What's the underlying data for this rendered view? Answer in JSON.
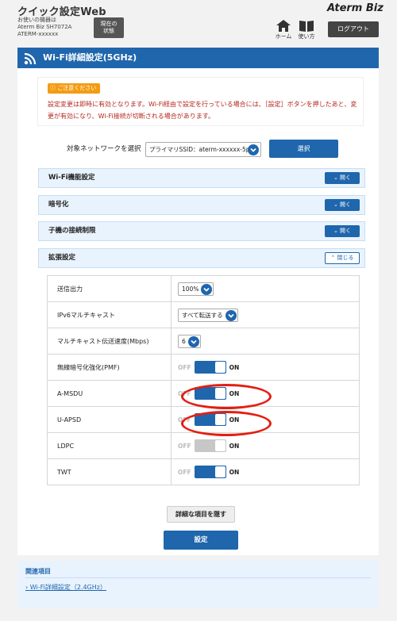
{
  "header": {
    "app_title": "クイック設定Web",
    "device_line1": "お使いの機器は",
    "device_line2": "Aterm Biz SH7072A",
    "device_line3": "ATERM-xxxxxx",
    "status_line1": "現在の",
    "status_line2": "状態",
    "brand": "Aterm Biz",
    "home_label": "ホーム",
    "help_label": "使い方",
    "logout_label": "ログアウト"
  },
  "page": {
    "title": "Wi-Fi詳細設定(5GHz)"
  },
  "notice": {
    "badge": "ご注意ください",
    "text": "設定変更は即時に有効となります。Wi-Fi経由で設定を行っている場合には、［設定］ボタンを押したあと、変更が有効になり、Wi-Fi接続が切断される場合があります。"
  },
  "network": {
    "label": "対象ネットワークを選択",
    "selected": "プライマリSSID：aterm-xxxxxx-5p",
    "select_button": "選択"
  },
  "sections": {
    "wifi": {
      "label": "Wi-Fi機能設定",
      "button": "開く"
    },
    "encryption": {
      "label": "暗号化",
      "button": "開く"
    },
    "restriction": {
      "label": "子機の接続制限",
      "button": "開く"
    },
    "extended": {
      "label": "拡張設定",
      "button": "閉じる"
    }
  },
  "settings": {
    "tx_power": {
      "label": "送信出力",
      "value": "100%"
    },
    "ipv6_multicast": {
      "label": "IPv6マルチキャスト",
      "value": "すべて転送する"
    },
    "multicast_rate": {
      "label": "マルチキャスト伝送速度(Mbps)",
      "value": "6"
    },
    "pmf": {
      "label": "無線暗号化強化(PMF)",
      "off": "OFF",
      "on": "ON",
      "state": "on"
    },
    "amsdu": {
      "label": "A-MSDU",
      "off": "OFF",
      "on": "ON",
      "state": "on"
    },
    "uapsd": {
      "label": "U-APSD",
      "off": "OFF",
      "on": "ON",
      "state": "on"
    },
    "ldpc": {
      "label": "LDPC",
      "off": "OFF",
      "on": "ON",
      "state": "disabled"
    },
    "twt": {
      "label": "TWT",
      "off": "OFF",
      "on": "ON",
      "state": "on"
    }
  },
  "actions": {
    "hide_details": "詳細な項目を隠す",
    "apply": "設定"
  },
  "related": {
    "title": "関連項目",
    "link": "Wi-Fi詳細設定（2.4GHz）"
  },
  "colors": {
    "primary": "#1f66ad",
    "notice_text": "#b3261e",
    "badge": "#f49b14",
    "highlight": "#e41e13"
  }
}
